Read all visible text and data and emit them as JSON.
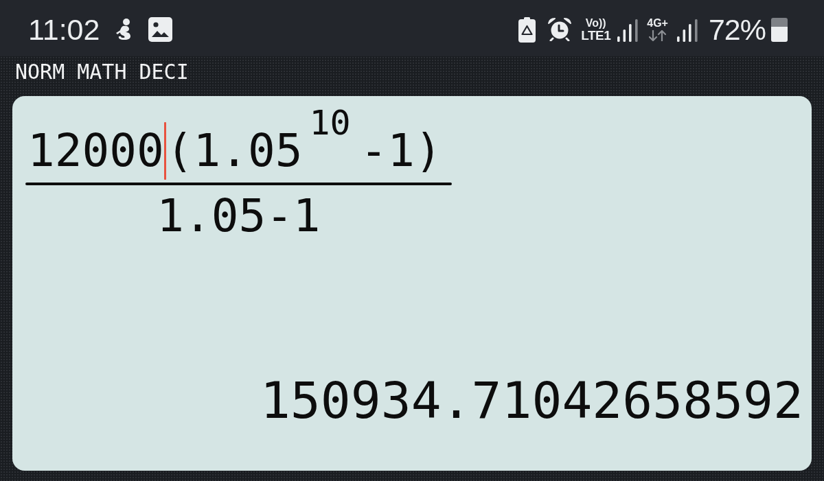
{
  "status_bar": {
    "time": "11:02",
    "voice_label": "Vo))",
    "network_label": "LTE1",
    "data_type": "4G+",
    "battery_percent": "72%"
  },
  "mode_indicators": [
    "NORM",
    "MATH",
    "DECI"
  ],
  "display": {
    "numerator": [
      {
        "kind": "text",
        "text": "12000"
      },
      {
        "kind": "cursor"
      },
      {
        "kind": "text",
        "text": "(1.05"
      },
      {
        "kind": "superscript",
        "text": "10"
      },
      {
        "kind": "text",
        "text": "-1)"
      }
    ],
    "denominator": "1.05-1",
    "result": "150934.71042658592"
  }
}
